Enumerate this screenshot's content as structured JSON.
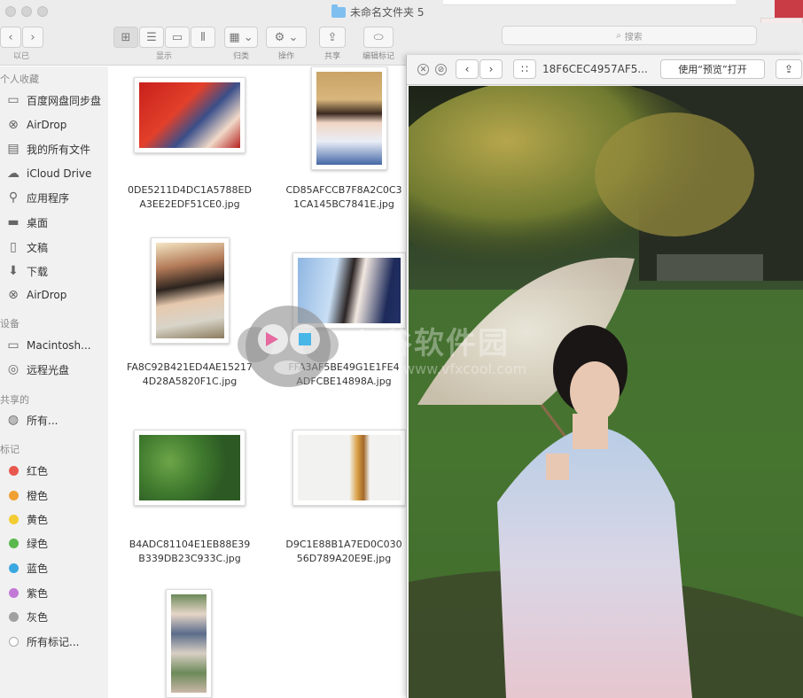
{
  "window": {
    "folder_title": "未命名文件夹 5"
  },
  "toolbar": {
    "back_label": "‹",
    "forward_label": "›",
    "nav_caption": "以已",
    "view_caption": "显示",
    "group_caption": "归类",
    "action_caption": "操作",
    "share_caption": "共享",
    "tags_caption": "编辑标记",
    "search_placeholder": "搜索"
  },
  "sidebar": {
    "section_favorites": "个人收藏",
    "favorites": [
      {
        "label": "百度网盘同步盘",
        "icon": "folder-icon"
      },
      {
        "label": "AirDrop",
        "icon": "airdrop-icon"
      },
      {
        "label": "我的所有文件",
        "icon": "all-files-icon"
      },
      {
        "label": "iCloud Drive",
        "icon": "cloud-icon"
      },
      {
        "label": "应用程序",
        "icon": "apps-icon"
      },
      {
        "label": "桌面",
        "icon": "desktop-icon"
      },
      {
        "label": "文稿",
        "icon": "documents-icon"
      },
      {
        "label": "下载",
        "icon": "download-icon"
      },
      {
        "label": "AirDrop",
        "icon": "airdrop-icon"
      }
    ],
    "section_devices": "设备",
    "devices": [
      {
        "label": "Macintosh...",
        "icon": "disk-icon"
      },
      {
        "label": "远程光盘",
        "icon": "disc-icon"
      }
    ],
    "section_shared": "共享的",
    "shared": [
      {
        "label": "所有...",
        "icon": "network-icon"
      }
    ],
    "section_tags": "标记",
    "tags": [
      {
        "label": "红色",
        "color": "#e8584f"
      },
      {
        "label": "橙色",
        "color": "#f0a032"
      },
      {
        "label": "黄色",
        "color": "#f3cc32"
      },
      {
        "label": "绿色",
        "color": "#5ab84c"
      },
      {
        "label": "蓝色",
        "color": "#3aa8e0"
      },
      {
        "label": "紫色",
        "color": "#c27ad6"
      },
      {
        "label": "灰色",
        "color": "#a0a0a0"
      },
      {
        "label": "所有标记...",
        "color": "#ffffff"
      }
    ]
  },
  "files": [
    {
      "name_line1": "0DE5211D4DC1A5788ED",
      "name_line2": "A3EE2EDF51CE0.jpg"
    },
    {
      "name_line1": "CD85AFCCB7F8A2C0C3",
      "name_line2": "1CA145BC7841E.jpg"
    },
    {
      "name_line1": "FA8C92B421ED4AE15217",
      "name_line2": "4D28A5820F1C.jpg"
    },
    {
      "name_line1": "FFA3AF5BE49G1E1FE4",
      "name_line2": "ADFCBE14898A.jpg"
    },
    {
      "name_line1": "B4ADC81104E1EB88E39",
      "name_line2": "B339DB23C933C.jpg"
    },
    {
      "name_line1": "D9C1E88B1A7ED0C030",
      "name_line2": "56D789A20E9E.jpg"
    }
  ],
  "quicklook": {
    "filename": "18F6CEC4957AF5...",
    "open_with_label": "使用“预览”打开",
    "prev_label": "‹",
    "next_label": "›"
  },
  "watermark": {
    "text": "心谷软件园",
    "url": "www.vfxcool.com"
  }
}
